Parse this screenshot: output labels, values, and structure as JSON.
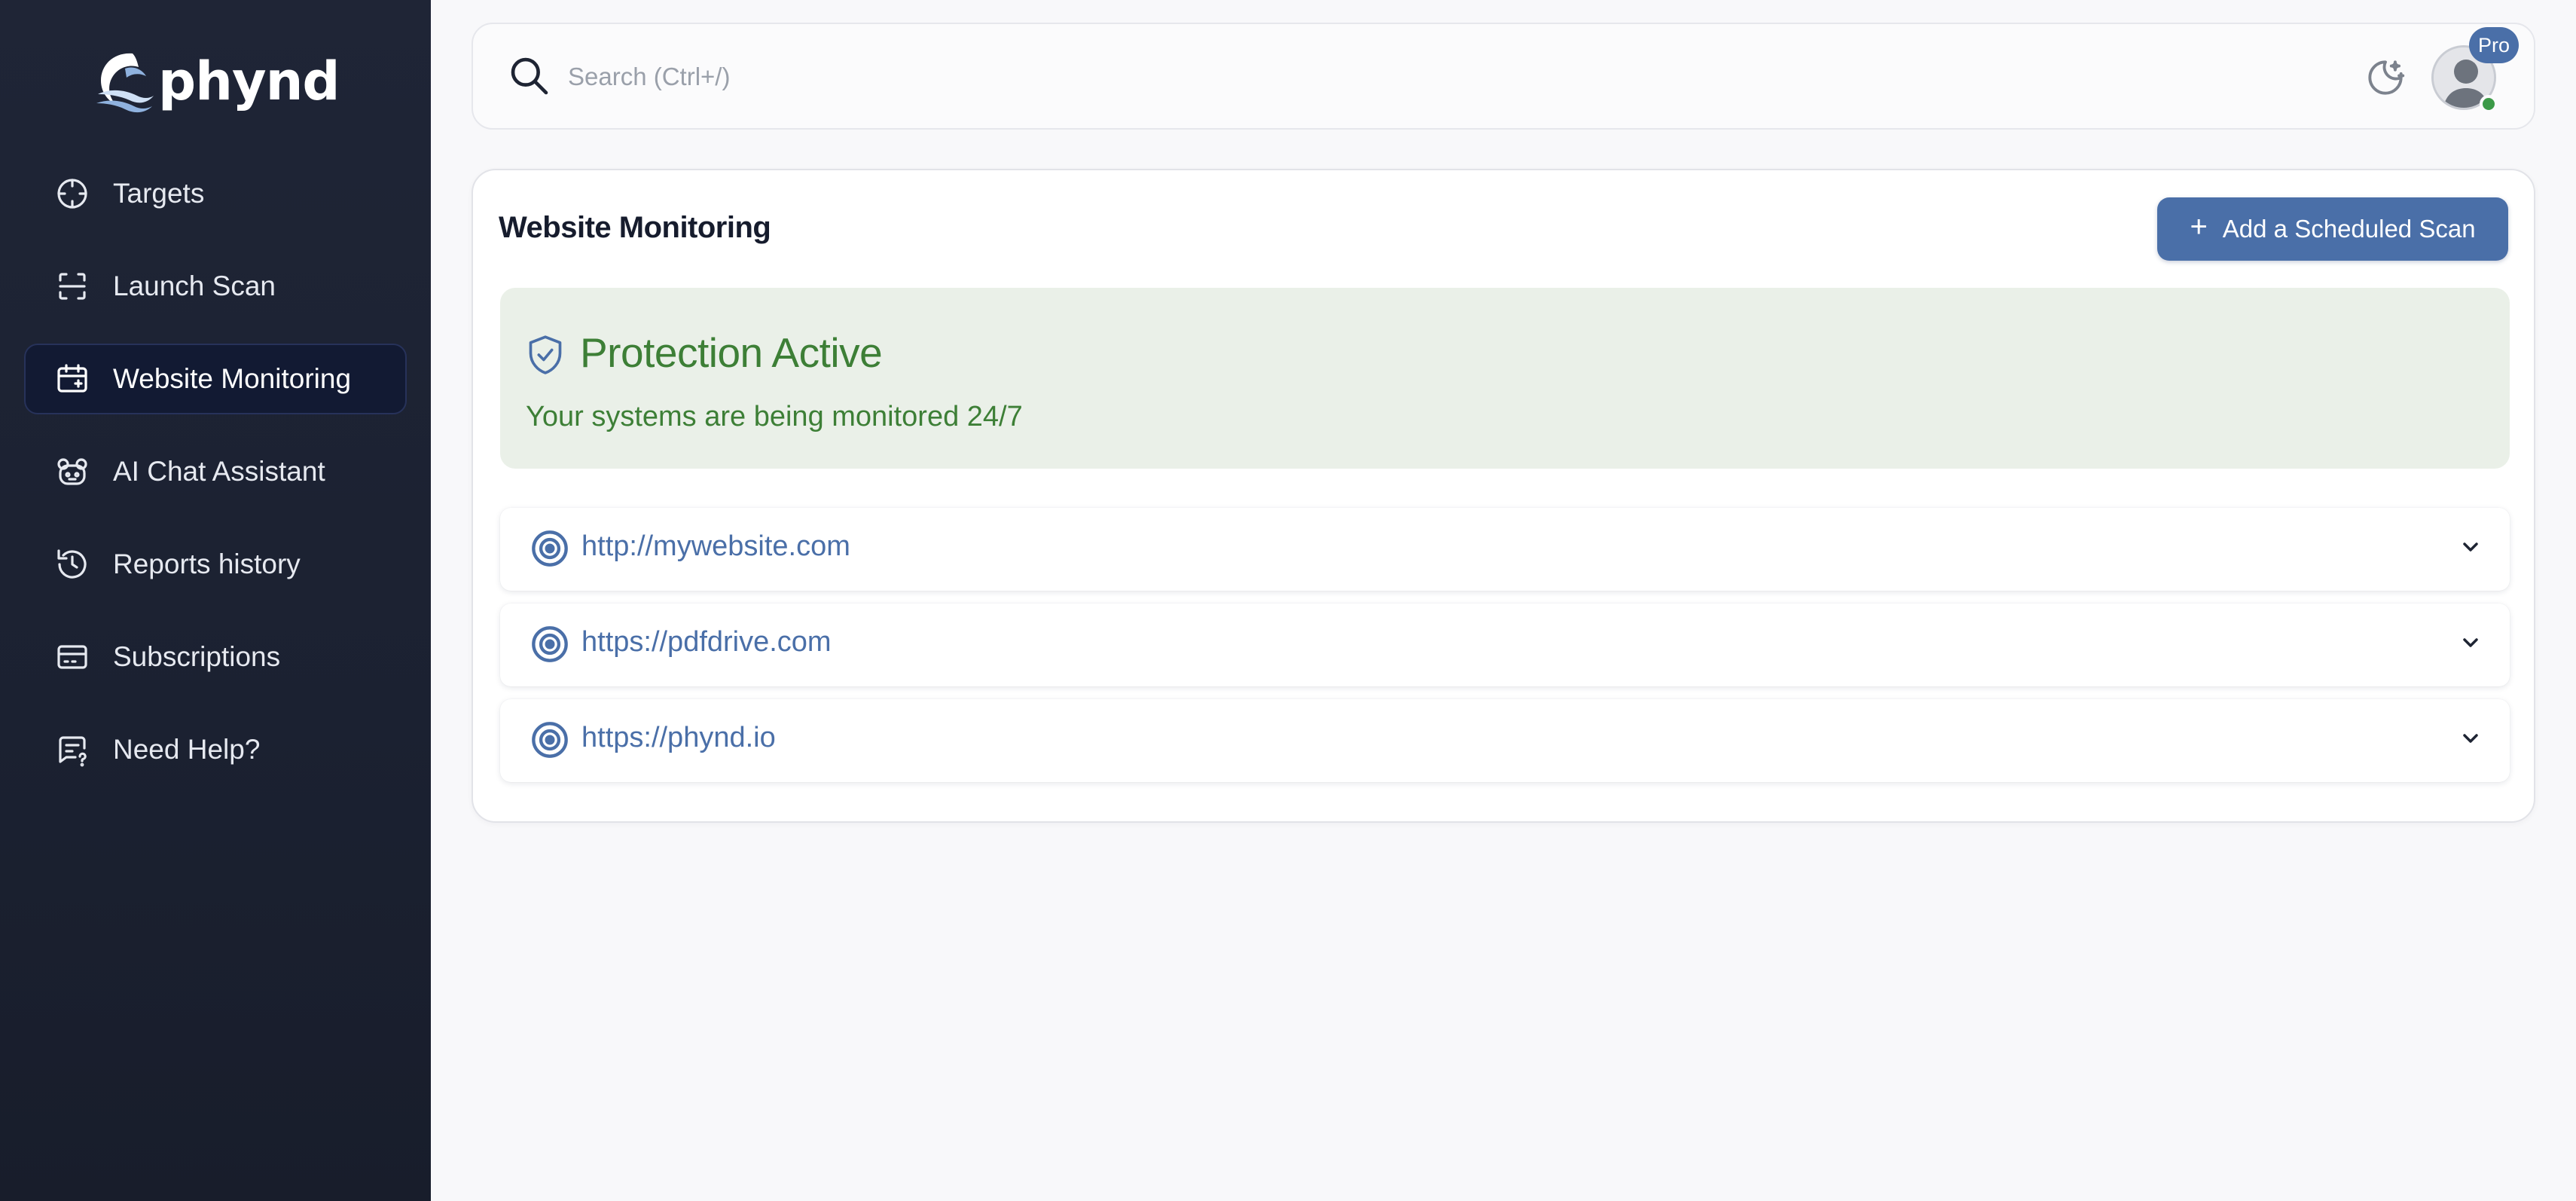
{
  "brand": {
    "name": "phynd"
  },
  "sidebar": {
    "items": [
      {
        "label": "Targets",
        "icon": "crosshair-icon",
        "active": false
      },
      {
        "label": "Launch Scan",
        "icon": "scan-icon",
        "active": false
      },
      {
        "label": "Website Monitoring",
        "icon": "monitor-calendar-icon",
        "active": true
      },
      {
        "label": "AI Chat Assistant",
        "icon": "robot-icon",
        "active": false
      },
      {
        "label": "Reports history",
        "icon": "history-icon",
        "active": false
      },
      {
        "label": "Subscriptions",
        "icon": "credit-card-icon",
        "active": false
      },
      {
        "label": "Need Help?",
        "icon": "help-chat-icon",
        "active": false
      }
    ]
  },
  "header": {
    "search": {
      "placeholder": "Search (Ctrl+/)",
      "value": ""
    },
    "badge": "Pro"
  },
  "main": {
    "title": "Website Monitoring",
    "add_button": "Add a Scheduled Scan",
    "status": {
      "title": "Protection Active",
      "subtitle": "Your systems are being monitored 24/7"
    },
    "sites": [
      {
        "url": "http://mywebsite.com"
      },
      {
        "url": "https://pdfdrive.com"
      },
      {
        "url": "https://phynd.io"
      }
    ]
  },
  "colors": {
    "sidebar_bg": "#1f2536",
    "accent": "#4a6fa8",
    "success_text": "#3d7f36",
    "success_bg": "#eaf0e8"
  }
}
